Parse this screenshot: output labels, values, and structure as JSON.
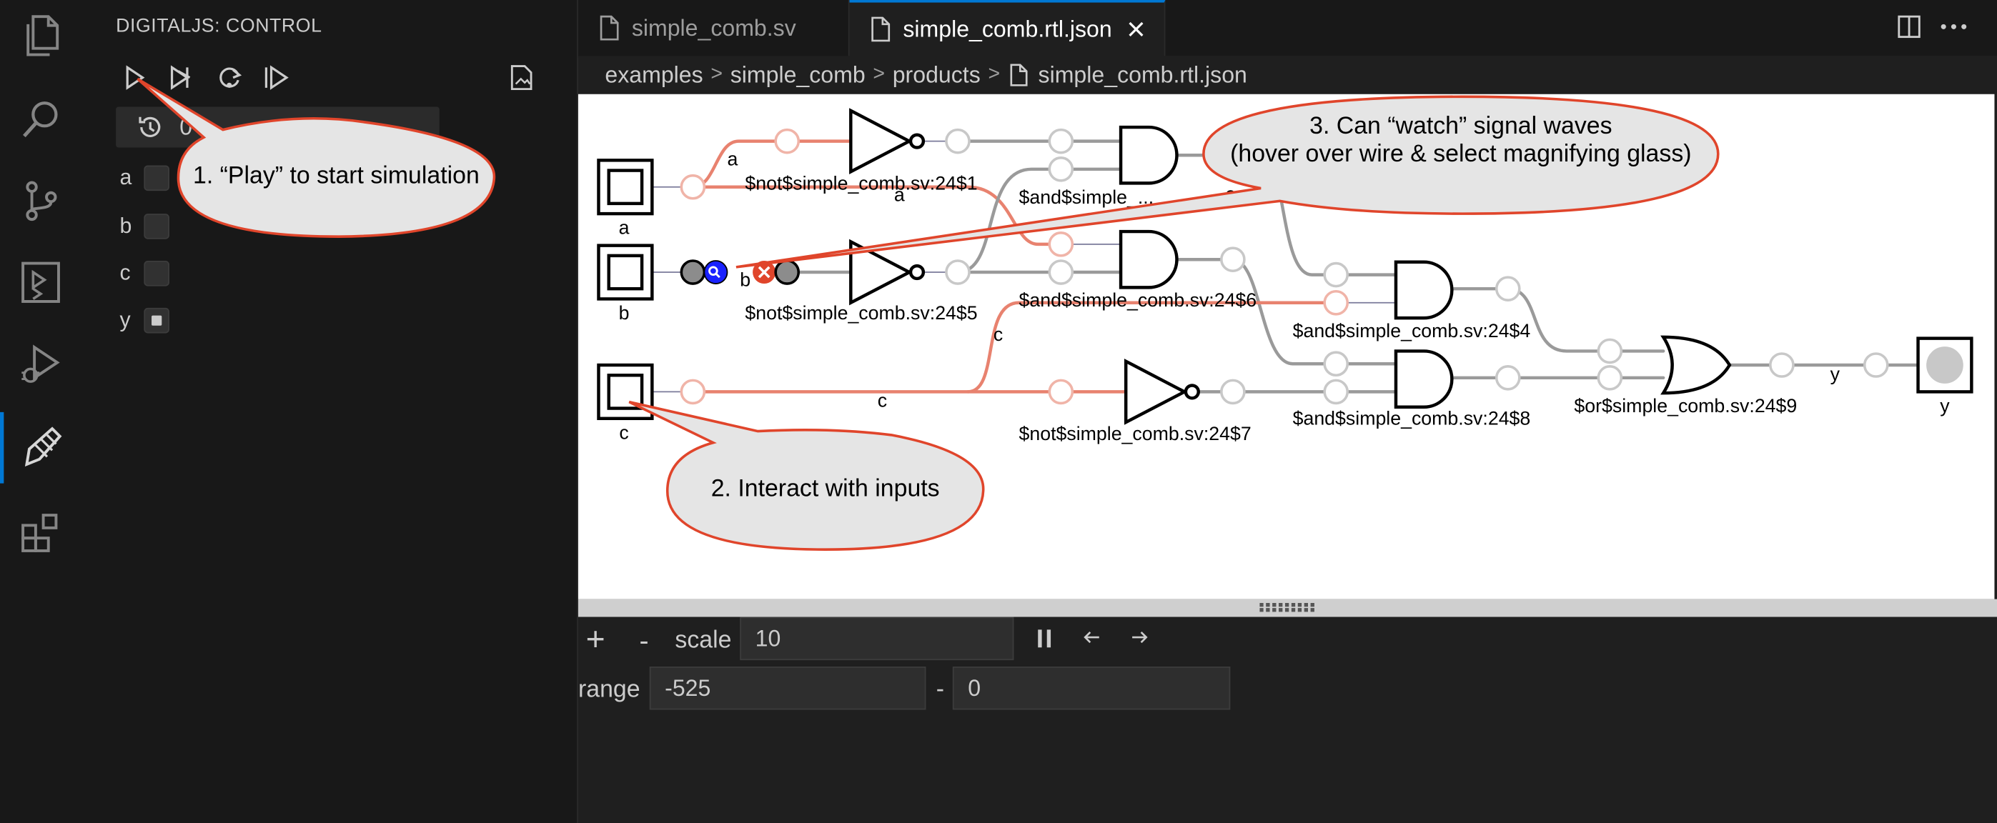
{
  "panel": {
    "title": "DIGITALJS: CONTROL",
    "time_value": "0",
    "signals": [
      {
        "name": "a",
        "checked": false
      },
      {
        "name": "b",
        "checked": false
      },
      {
        "name": "c",
        "checked": false
      },
      {
        "name": "y",
        "checked": true
      }
    ]
  },
  "tabs": [
    {
      "label": "simple_comb.sv",
      "active": false
    },
    {
      "label": "simple_comb.rtl.json",
      "active": true
    }
  ],
  "breadcrumb": [
    "examples",
    "simple_comb",
    "products",
    "simple_comb.rtl.json"
  ],
  "circuit": {
    "inputs": [
      "a",
      "b",
      "c"
    ],
    "output": "y",
    "gates": {
      "not1": "$not$simple_comb.sv:24$1",
      "and3_partial": "$and$simple_...",
      "and3_tail": "24$3",
      "not5": "$not$simple_comb.sv:24$5",
      "and6": "$and$simple_comb.sv:24$6",
      "and4": "$and$simple_comb.sv:24$4",
      "not7": "$not$simple_comb.sv:24$7",
      "and8": "$and$simple_comb.sv:24$8",
      "or9": "$or$simple_comb.sv:24$9"
    },
    "wire_labels": {
      "a1": "a",
      "a2": "a",
      "b": "b",
      "c1": "c",
      "c2": "c",
      "y": "y"
    }
  },
  "callouts": {
    "play": "1. “Play” to start simulation",
    "inputs": "2. Interact with inputs",
    "watch_line1": "3. Can “watch” signal waves",
    "watch_line2": "(hover over wire & select magnifying glass)"
  },
  "waveform": {
    "scale_label": "scale",
    "scale_value": "10",
    "range_label": "range",
    "range_start": "-525",
    "range_dash": "-",
    "range_end": "0",
    "plus": "+",
    "minus": "-"
  },
  "colors": {
    "accent": "#0078d4",
    "active_wire": "#e8826f",
    "callout_border": "#e0452b",
    "callout_fill": "#e5e5e5"
  }
}
